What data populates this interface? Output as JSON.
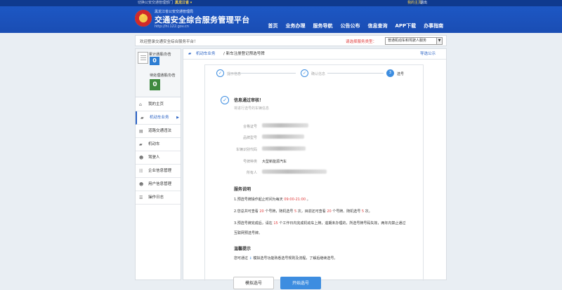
{
  "topbar": {
    "location_prefix": "切换公安交通管理部门",
    "province": "黑龙江省 ▾",
    "login": "我的主页",
    "register": "退出"
  },
  "brand": {
    "subtitle": "黑龙江省公安交通管理局",
    "title": "交通安全综合服务管理平台",
    "url": "http://hl.122.gov.cn"
  },
  "nav": [
    "首页",
    "业务办理",
    "服务导航",
    "公告公布",
    "信息查询",
    "APP下载",
    "办事指南"
  ],
  "welcome_bar": {
    "text": "欢迎登录交通安全综合服务平台！",
    "service_label": "请选择服务类型：",
    "service_value": "普通机动车和驾驶人服务"
  },
  "sidebar": {
    "stat1_label": "累计通报/办告",
    "stat1_value": "0",
    "stat2_label": "待处理通报/办告",
    "stat2_value": "0",
    "menu": [
      {
        "label": "我的主页",
        "icon": "home-icon",
        "glyph": "⌂"
      },
      {
        "label": "机动车业务",
        "icon": "car-icon",
        "glyph": "▰",
        "active": true
      },
      {
        "label": "道路交通违法",
        "icon": "ticket-icon",
        "glyph": "▤"
      },
      {
        "label": "机动车",
        "icon": "vehicle-icon",
        "glyph": "▰"
      },
      {
        "label": "驾驶人",
        "icon": "user-icon",
        "glyph": "☻"
      },
      {
        "label": "企业信息管理",
        "icon": "team-icon",
        "glyph": "☷"
      },
      {
        "label": "用户信息管理",
        "icon": "profile-icon",
        "glyph": "☻"
      },
      {
        "label": "操作日志",
        "icon": "log-icon",
        "glyph": "☰"
      }
    ]
  },
  "breadcrumb": {
    "section": "机动车业务",
    "page": "/ 新车注册登记预选号牌",
    "guide": "导选公示"
  },
  "steps": [
    {
      "label": "提示信息",
      "done": true,
      "glyph": "✓"
    },
    {
      "label": "确认信息",
      "done": true,
      "glyph": "✓"
    },
    {
      "label": "选号",
      "done": false,
      "glyph": "3"
    }
  ],
  "result": {
    "title": "信息通过审核！",
    "subtitle": "将进行选号的车辆信息"
  },
  "fields": [
    {
      "label": "合格证号"
    },
    {
      "label": "品牌型号"
    },
    {
      "label": "车辆识别代码"
    },
    {
      "label": "号牌种类",
      "value": "大型新能源汽车"
    },
    {
      "label": "所有人"
    }
  ],
  "service_notes": {
    "title": "服务说明",
    "line1_pre": "1.预选号牌操作起止时间为每天 ",
    "line1_time": "09:00-21:00",
    "line1_post": " 。",
    "line2_a": "2.您总共可查看 ",
    "line2_n1": "20",
    "line2_b": " 个号牌，随机选号 ",
    "line2_n2": "5",
    "line2_c": " 次，目前还可查看 ",
    "line2_n3": "20",
    "line2_d": " 个号牌、随机选号 ",
    "line2_n4": "5",
    "line2_e": " 次。",
    "line3_a": "3.预选号牌完成后，请在 ",
    "line3_n": "15",
    "line3_b": " 个工作日内完成机动车上牌，逾期未办理的，所选号牌号码失效，两年内禁止通过",
    "line3_c": "互联网预选号牌。"
  },
  "tips": {
    "title": "温馨提示",
    "text_a": "您可通过 ",
    "text_icon": "⇓",
    "text_b": " 模拟选号功能熟悉选号规则及流程，了解后继续选号。"
  },
  "buttons": {
    "simulate": "模拟选号",
    "start": "开始选号"
  }
}
